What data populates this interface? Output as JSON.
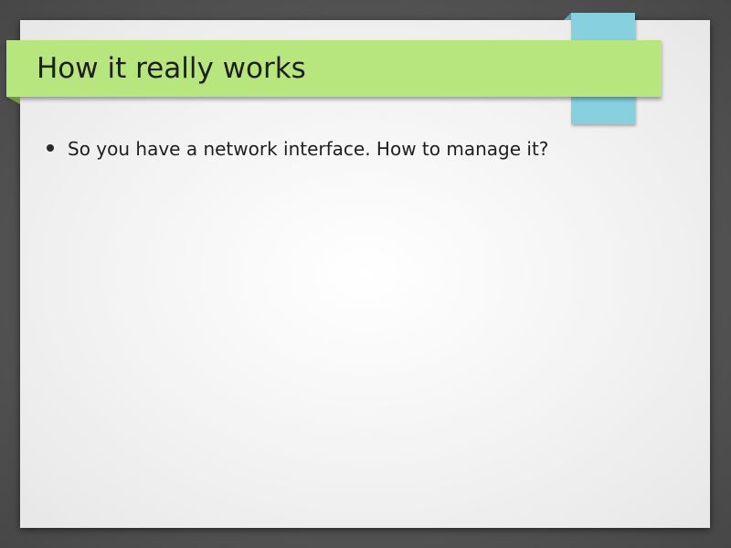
{
  "slide": {
    "title": "How it really works",
    "bullets": [
      "So you have a network interface. How to manage it?"
    ]
  },
  "colors": {
    "title_band": "#b8e67e",
    "accent_tab": "#86d0df",
    "frame": "#565656",
    "text": "#1e1e1e"
  }
}
